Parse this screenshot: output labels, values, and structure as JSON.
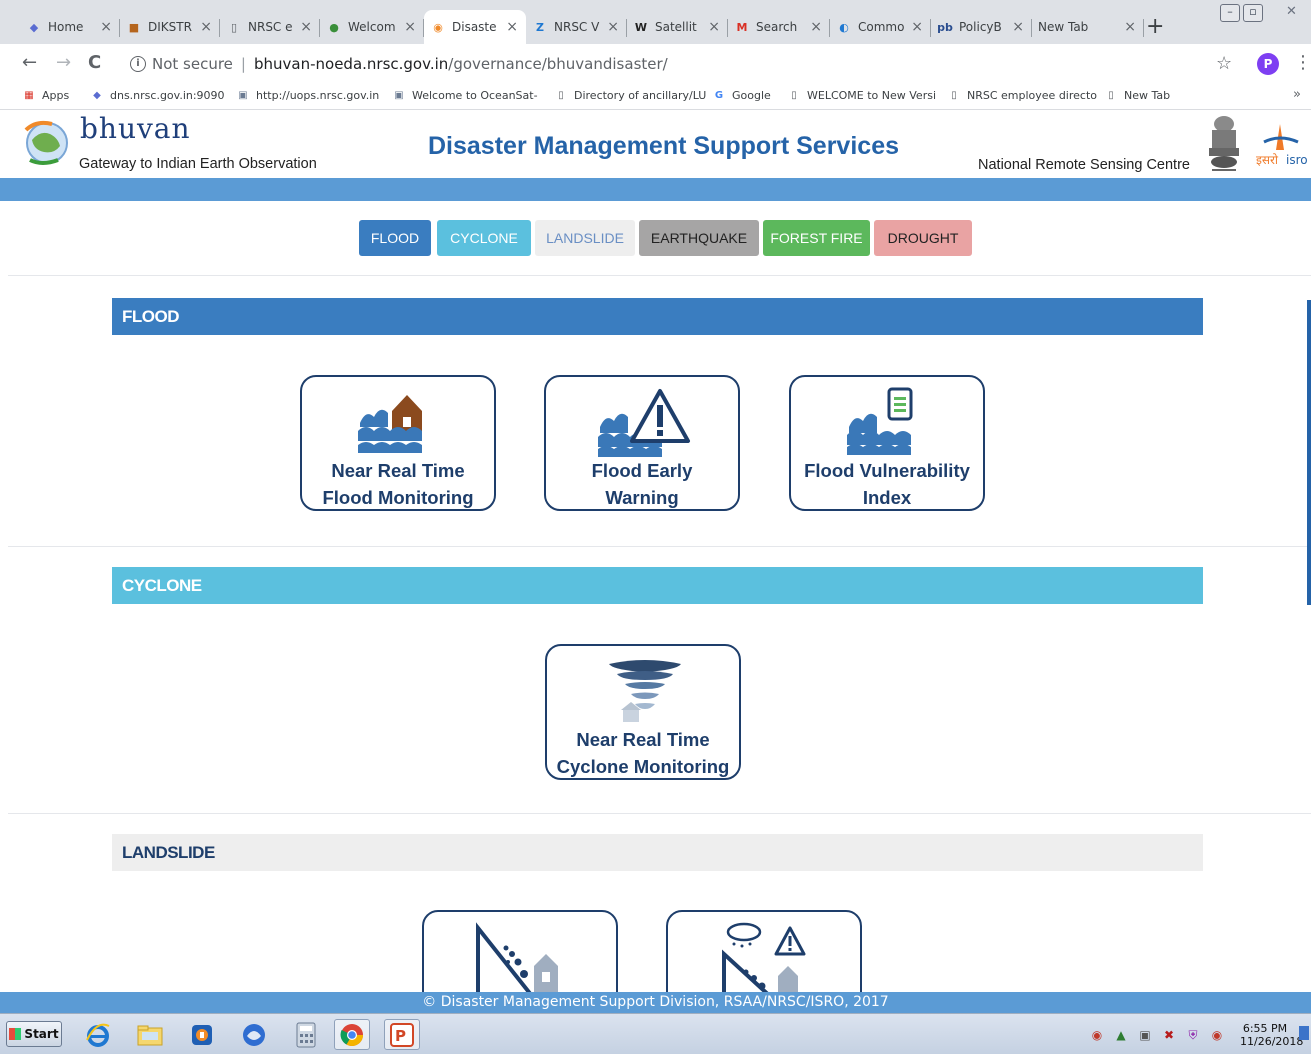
{
  "browser": {
    "tabs": [
      {
        "label": "Home",
        "icon": "diamond-icon"
      },
      {
        "label": "DIKSTR",
        "icon": "app-icon"
      },
      {
        "label": "NRSC e",
        "icon": "page-icon"
      },
      {
        "label": "Welcom",
        "icon": "globe-icon"
      },
      {
        "label": "Disaste",
        "icon": "bhuvan-icon",
        "active": true
      },
      {
        "label": "NRSC V",
        "icon": "z-icon"
      },
      {
        "label": "Satellit",
        "icon": "wikipedia-icon"
      },
      {
        "label": "Search",
        "icon": "gmail-icon"
      },
      {
        "label": "Commo",
        "icon": "spinner-icon"
      },
      {
        "label": "PolicyB",
        "icon": "pb-icon"
      },
      {
        "label": "New Tab",
        "icon": ""
      }
    ],
    "close_glyph": "×",
    "new_tab_glyph": "+",
    "address": {
      "security": "Not secure",
      "host": "bhuvan-noeda.nrsc.gov.in",
      "path": "/governance/bhuvandisaster/"
    },
    "profile_initial": "P",
    "bookmarks": [
      {
        "label": "Apps",
        "icon": "apps-grid-icon"
      },
      {
        "label": "dns.nrsc.gov.in:9090",
        "icon": "diamond-icon"
      },
      {
        "label": "http://uops.nrsc.gov.in",
        "icon": "image-icon"
      },
      {
        "label": "Welcome to OceanSat-",
        "icon": "image-icon"
      },
      {
        "label": "Directory of ancillary/LU",
        "icon": "page-icon"
      },
      {
        "label": "Google",
        "icon": "google-icon"
      },
      {
        "label": "WELCOME to New Versi",
        "icon": "page-icon"
      },
      {
        "label": "NRSC employee directo",
        "icon": "page-icon"
      },
      {
        "label": "New Tab",
        "icon": "page-icon"
      }
    ],
    "bookmarks_overflow": "»"
  },
  "site": {
    "logo_word": "bhuvan",
    "logo_tagline": "Gateway to Indian Earth Observation",
    "title": "Disaster Management Support Services",
    "org": "National Remote Sensing Centre",
    "isro_text": "इसरो isro"
  },
  "categories": [
    {
      "label": "FLOOD",
      "bg": "#3a7dc0",
      "fg": "#ffffff"
    },
    {
      "label": "CYCLONE",
      "bg": "#5bc0de",
      "fg": "#ffffff"
    },
    {
      "label": "LANDSLIDE",
      "bg": "#eeeeee",
      "fg": "#6a8fc4"
    },
    {
      "label": "EARTHQUAKE",
      "bg": "#a6a5a5",
      "fg": "#222222"
    },
    {
      "label": "FOREST FIRE",
      "bg": "#5cb85c",
      "fg": "#ffffff"
    },
    {
      "label": "DROUGHT",
      "bg": "#e9a3a3",
      "fg": "#222222"
    }
  ],
  "sections": {
    "flood": {
      "title": "FLOOD",
      "bar_color": "#3a7dc0",
      "cards": [
        {
          "line1": "Near Real Time",
          "line2": "Flood Monitoring",
          "icon": "flood-house-icon"
        },
        {
          "line1": "Flood Early",
          "line2": "Warning",
          "icon": "flood-warning-icon"
        },
        {
          "line1": "Flood Vulnerability",
          "line2": "Index",
          "icon": "flood-vulnerability-icon"
        }
      ]
    },
    "cyclone": {
      "title": "CYCLONE",
      "bar_color": "#5bc0de",
      "cards": [
        {
          "line1": "Near Real Time",
          "line2": "Cyclone Monitoring",
          "icon": "cyclone-icon"
        }
      ]
    },
    "landslide": {
      "title": "LANDSLIDE",
      "bar_color": "#eeeeee",
      "cards": [
        {
          "icon": "landslide-icon"
        },
        {
          "icon": "landslide-warning-icon"
        }
      ]
    }
  },
  "footer": "© Disaster Management Support Division, RSAA/NRSC/ISRO, 2017",
  "taskbar": {
    "start_label": "Start",
    "apps": [
      "ie-icon",
      "folder-icon",
      "media-icon",
      "thunderbird-icon",
      "calculator-icon",
      "chrome-icon",
      "powerpoint-icon"
    ],
    "clock_time": "6:55 PM",
    "clock_date": "11/26/2018"
  }
}
